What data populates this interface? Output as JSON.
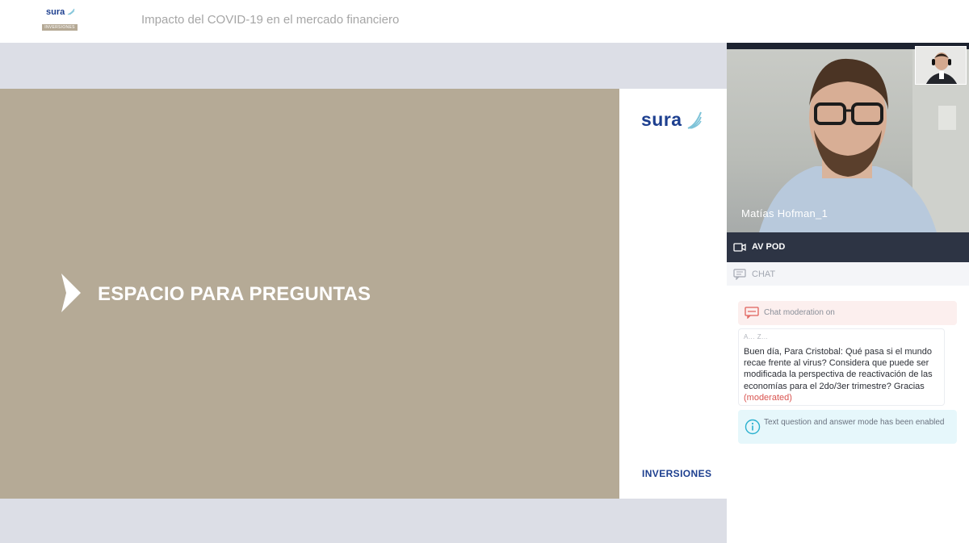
{
  "header": {
    "logo_word": "sura",
    "logo_tag": "INVERSIONES",
    "title": "Impacto del COVID-19 en el mercado financiero"
  },
  "slide": {
    "heading": "ESPACIO PARA PREGUNTAS",
    "logo_word": "sura",
    "footer": "INVERSIONES",
    "background_color": "#b5aa96",
    "brand_color": "#1d3f8f"
  },
  "video": {
    "presenter_name": "Matías Hofman_1"
  },
  "pods": {
    "av_pod_label": "AV POD",
    "chat_label": "CHAT"
  },
  "chat": {
    "moderation_notice": "Chat moderation on",
    "messages": [
      {
        "sender": "A... Z...",
        "text": "Buen día, Para Cristobal: Qué pasa si el mundo recae frente al virus? Considera que puede ser modificada la perspectiva de reactivación de las economías para el 2do/3er trimestre? Gracias",
        "status": "(moderated)"
      }
    ],
    "info_notice": "Text question and answer mode has been enabled"
  },
  "icons": {
    "video_camera": "video-camera-icon",
    "chat": "chat-icon",
    "moderation": "moderation-icon",
    "info": "info-icon",
    "chevron": "chevron-right-icon"
  }
}
